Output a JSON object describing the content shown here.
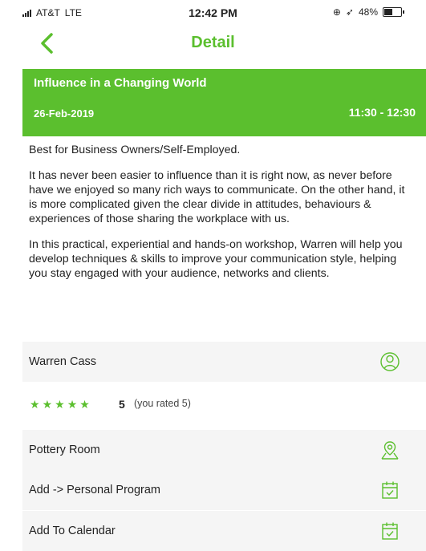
{
  "status_bar": {
    "carrier": "AT&T",
    "network": "LTE",
    "time": "12:42 PM",
    "battery": "48%",
    "battery_level": 0.48
  },
  "nav": {
    "title": "Detail",
    "back_icon": "chevron-left-icon"
  },
  "event": {
    "title": "Influence in a Changing World",
    "date": "26-Feb-2019",
    "time": "11:30 - 12:30"
  },
  "description": {
    "audience": "Best for Business Owners/Self-Employed.",
    "paragraph1": "It has never been easier to influence than it is right now, as never before have we enjoyed so many rich ways to communicate. On the other hand, it is more complicated given the clear divide in attitudes, behaviours & experiences of those sharing the workplace with us.",
    "paragraph2": "In this practical, experiential and hands-on workshop, Warren will help you develop techniques & skills to improve your communication style, helping you stay engaged with your audience, networks and clients."
  },
  "speaker": {
    "name": "Warren Cass",
    "icon": "person-icon"
  },
  "rating": {
    "stars": 5,
    "value": "5",
    "note": "(you rated 5)"
  },
  "location": {
    "label": "Pottery Room",
    "icon": "map-pin-icon"
  },
  "actions": {
    "add_program": "Add -> Personal Program",
    "add_calendar": "Add To Calendar",
    "icon": "calendar-check-icon"
  },
  "colors": {
    "accent": "#5bbf2e",
    "row_bg": "#f5f5f5"
  }
}
